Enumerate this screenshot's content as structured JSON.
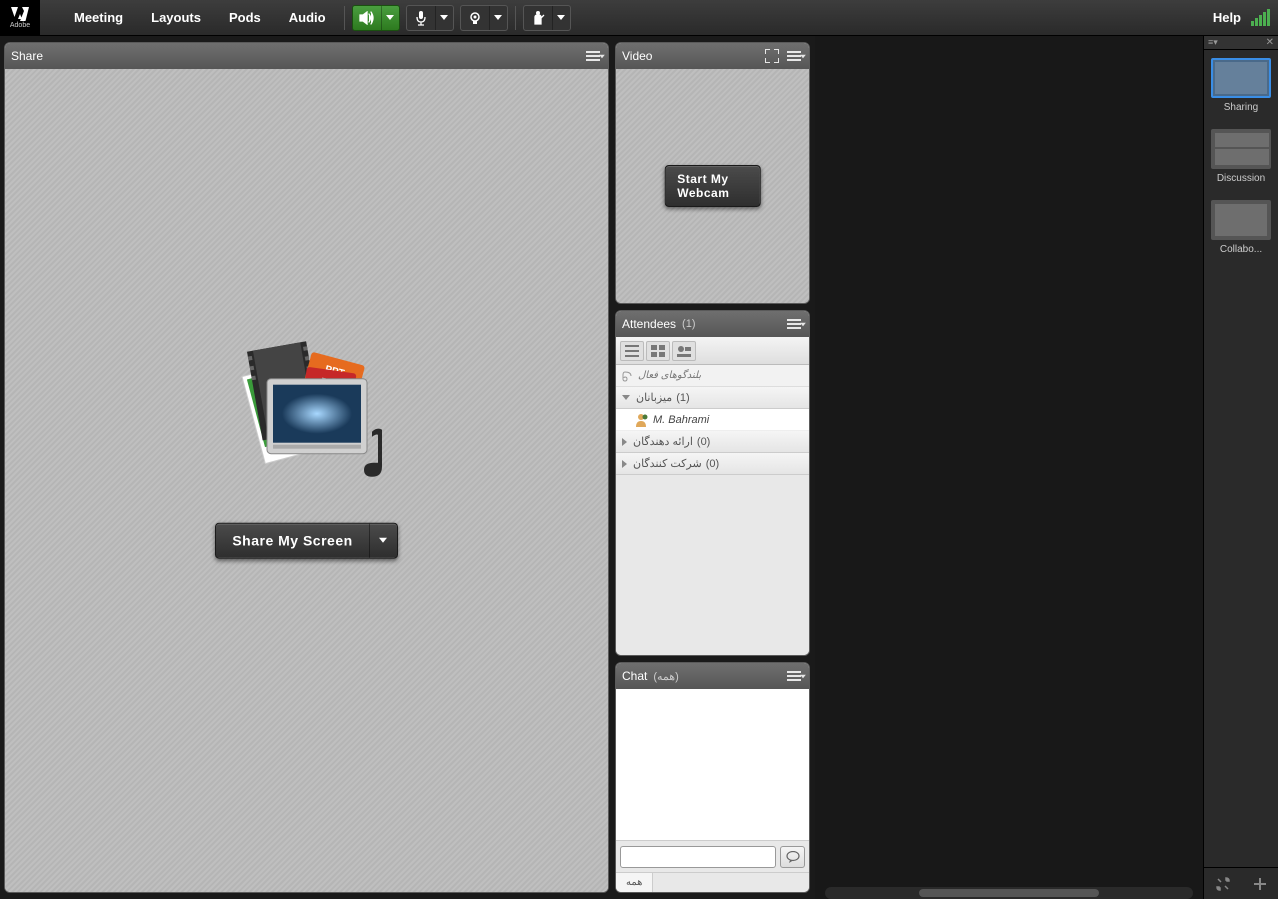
{
  "app": {
    "logo_text": "Adobe"
  },
  "menu": {
    "meeting": "Meeting",
    "layouts": "Layouts",
    "pods": "Pods",
    "audio": "Audio"
  },
  "help": "Help",
  "pods": {
    "share": {
      "title": "Share",
      "button": "Share My Screen"
    },
    "video": {
      "title": "Video",
      "button": "Start My Webcam"
    },
    "attendees": {
      "title": "Attendees",
      "count": "(1)",
      "active_speakers": "بلندگوهای فعال",
      "hosts": {
        "label": "میزبانان",
        "count": "(1)"
      },
      "presenters": {
        "label": "ارائه دهندگان",
        "count": "(0)"
      },
      "participants": {
        "label": "شرکت کنندگان",
        "count": "(0)"
      },
      "user": "M. Bahrami"
    },
    "chat": {
      "title": "Chat",
      "scope": "(همه)",
      "tab_all": "همه",
      "placeholder": ""
    }
  },
  "layouts": {
    "sharing": "Sharing",
    "discussion": "Discussion",
    "collaboration": "Collabo..."
  }
}
